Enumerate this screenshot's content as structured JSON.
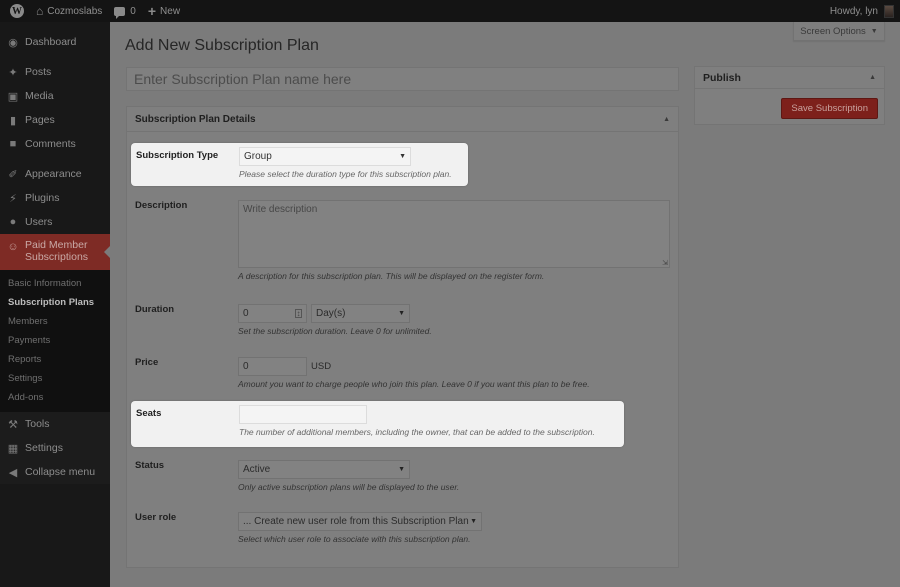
{
  "admin_bar": {
    "site_name": "Cozmoslabs",
    "comments_count": "0",
    "new_label": "New",
    "greeting": "Howdy, lyn"
  },
  "sidebar": {
    "items": [
      {
        "label": "Dashboard",
        "icon": "dashboard-icon"
      },
      {
        "label": "Posts",
        "icon": "pin-icon"
      },
      {
        "label": "Media",
        "icon": "media-icon"
      },
      {
        "label": "Pages",
        "icon": "pages-icon"
      },
      {
        "label": "Comments",
        "icon": "comment-icon"
      },
      {
        "label": "Appearance",
        "icon": "brush-icon"
      },
      {
        "label": "Plugins",
        "icon": "plugin-icon"
      },
      {
        "label": "Users",
        "icon": "user-icon"
      },
      {
        "label": "Paid Member Subscriptions",
        "icon": "member-icon"
      }
    ],
    "submenu": [
      "Basic Information",
      "Subscription Plans",
      "Members",
      "Payments",
      "Reports",
      "Settings",
      "Add-ons"
    ],
    "lower": [
      {
        "label": "Tools",
        "icon": "wrench-icon"
      },
      {
        "label": "Settings",
        "icon": "settings-icon"
      },
      {
        "label": "Collapse menu",
        "icon": "collapse-icon"
      }
    ]
  },
  "header": {
    "screen_options": "Screen Options",
    "page_title": "Add New Subscription Plan",
    "name_placeholder": "Enter Subscription Plan name here"
  },
  "details": {
    "title": "Subscription Plan Details",
    "subscription_type": {
      "label": "Subscription Type",
      "value": "Group",
      "desc": "Please select the duration type for this subscription plan."
    },
    "description": {
      "label": "Description",
      "placeholder": "Write description",
      "desc": "A description for this subscription plan. This will be displayed on the register form."
    },
    "duration": {
      "label": "Duration",
      "value": "0",
      "unit": "Day(s)",
      "desc": "Set the subscription duration. Leave 0 for unlimited."
    },
    "price": {
      "label": "Price",
      "value": "0",
      "currency": "USD",
      "desc": "Amount you want to charge people who join this plan. Leave 0 if you want this plan to be free."
    },
    "seats": {
      "label": "Seats",
      "value": "",
      "desc": "The number of additional members, including the owner, that can be added to the subscription."
    },
    "status": {
      "label": "Status",
      "value": "Active",
      "desc": "Only active subscription plans will be displayed to the user."
    },
    "user_role": {
      "label": "User role",
      "value": "... Create new user role from this Subscription Plan",
      "desc": "Select which user role to associate with this subscription plan."
    }
  },
  "publish": {
    "title": "Publish",
    "save_label": "Save Subscription"
  },
  "colors": {
    "accent": "#d54e3b",
    "highlight_bg": "#f1f1f1"
  }
}
